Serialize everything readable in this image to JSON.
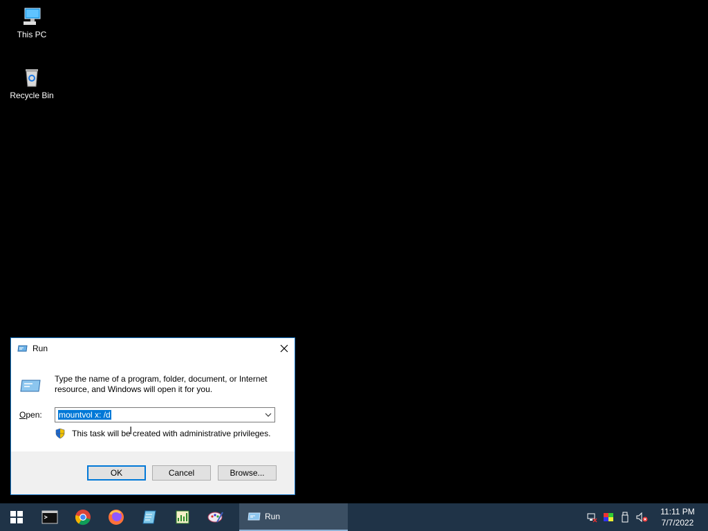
{
  "desktop": {
    "icons": [
      {
        "label": "This PC",
        "icon": "computer-icon"
      },
      {
        "label": "Recycle Bin",
        "icon": "recycle-bin-icon"
      }
    ]
  },
  "run_dialog": {
    "title": "Run",
    "description": "Type the name of a program, folder, document, or Internet resource, and Windows will open it for you.",
    "open_label_prefix": "O",
    "open_label_rest": "pen:",
    "open_value": "mountvol x: /d",
    "admin_note": "This task will be created with administrative privileges.",
    "buttons": {
      "ok": "OK",
      "cancel": "Cancel",
      "browse": "Browse..."
    }
  },
  "taskbar": {
    "pinned": [
      "start-icon",
      "command-prompt-icon",
      "chrome-icon",
      "firefox-icon",
      "notepad-icon",
      "spreadsheet-icon",
      "paint-icon"
    ],
    "active_window": "Run",
    "tray_icons": [
      "network-icon",
      "color-icon",
      "usb-icon",
      "volume-muted-icon"
    ],
    "time": "11:11 PM",
    "date": "7/7/2022"
  },
  "colors": {
    "accent": "#0078d7",
    "taskbar": "#1f3347"
  }
}
